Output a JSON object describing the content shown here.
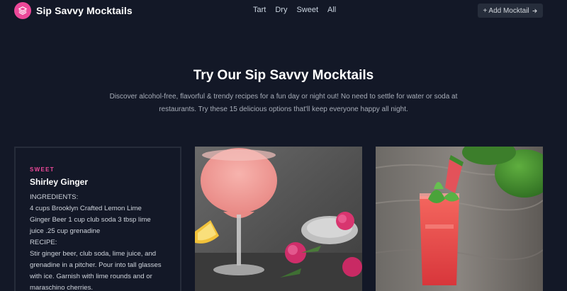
{
  "brand": {
    "name": "Sip Savvy Mocktails",
    "logo_icon": "layers-icon",
    "accent": "#ec4899"
  },
  "nav": {
    "links": [
      "Tart",
      "Dry",
      "Sweet",
      "All"
    ]
  },
  "add_button": {
    "label": "+ Add Mocktail",
    "icon": "arrow-right-icon"
  },
  "hero": {
    "title": "Try Our Sip Savvy Mocktails",
    "description_line1": "Discover alcohol-free, flavorful & trendy recipes for a fun day or night out! No need to settle for water or soda at",
    "description_line2": "restaurants. Try these 15 delicious options that'll keep everyone happy all night."
  },
  "cards": [
    {
      "tag": "SWEET",
      "title": "Shirley Ginger",
      "lines": [
        "INGREDIENTS:",
        "4 cups Brooklyn Crafted Lemon Lime",
        "Ginger Beer 1 cup club soda 3 tbsp lime",
        "juice .25 cup grenadine",
        "RECIPE:",
        "Stir ginger beer, club soda, lime juice, and",
        "grenadine in a pitcher. Pour into tall glasses",
        "with ice. Garnish with lime rounds and or",
        "maraschino cherries."
      ]
    }
  ],
  "images": [
    {
      "name": "pink-coupe-cocktail-photo"
    },
    {
      "name": "watermelon-drink-photo"
    }
  ]
}
